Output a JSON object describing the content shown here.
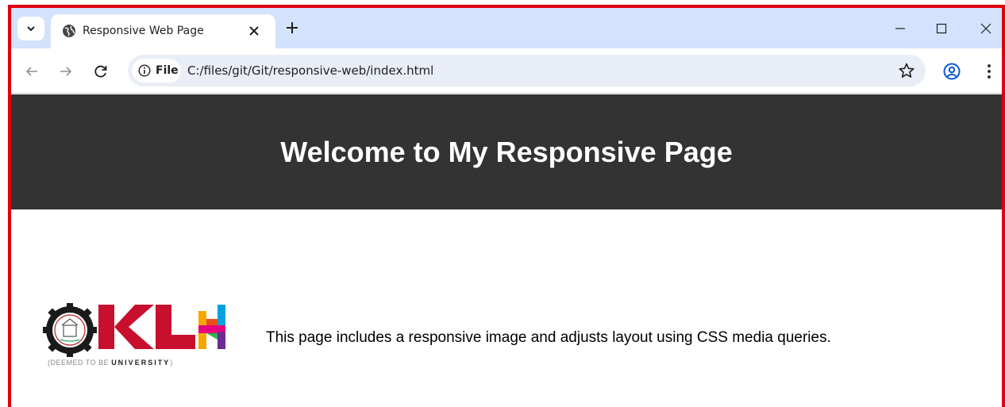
{
  "browser": {
    "tab": {
      "title": "Responsive Web Page",
      "favicon": "globe-icon"
    },
    "toolbar": {
      "site_chip_label": "File",
      "url": "C:/files/git/Git/responsive-web/index.html"
    },
    "colors": {
      "tabstrip": "#d3e3fd",
      "omnibox": "#e9eef6",
      "accent": "#0b57d0"
    }
  },
  "page": {
    "header": {
      "title": "Welcome to My Responsive Page",
      "background": "#333333"
    },
    "logo": {
      "caption_prefix": "(DEEMED TO BE ",
      "caption_main": "UNIVERSITY",
      "caption_suffix": ")",
      "wordmark": "KLH"
    },
    "content": {
      "text": "This page includes a responsive image and adjusts layout using CSS media queries."
    }
  },
  "frame_border_color": "#e0000f"
}
